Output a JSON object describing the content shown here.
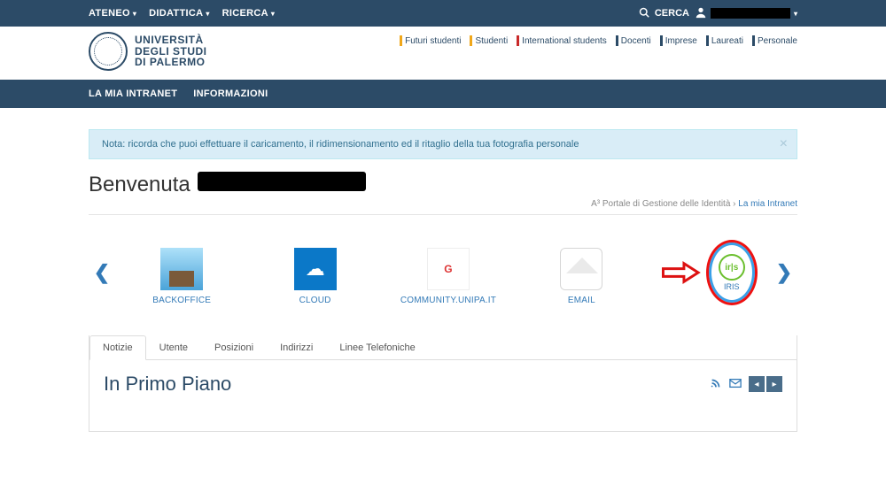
{
  "topbar": {
    "items": [
      "ATENEO",
      "DIDATTICA",
      "RICERCA"
    ],
    "search_label": "CERCA"
  },
  "quicklinks": [
    {
      "label": "Futuri studenti",
      "color": "#f0a71a"
    },
    {
      "label": "Studenti",
      "color": "#f0a71a"
    },
    {
      "label": "International students",
      "color": "#c92a2a"
    },
    {
      "label": "Docenti",
      "color": "#2c4b67"
    },
    {
      "label": "Imprese",
      "color": "#2c4b67"
    },
    {
      "label": "Laureati",
      "color": "#2c4b67"
    },
    {
      "label": "Personale",
      "color": "#2c4b67"
    }
  ],
  "logo": {
    "line1": "UNIVERSITÀ",
    "line2": "DEGLI STUDI",
    "line3": "DI PALERMO"
  },
  "nav2": {
    "items": [
      "LA MIA INTRANET",
      "INFORMAZIONI"
    ]
  },
  "alert": {
    "text": "Nota: ricorda che puoi effettuare il caricamento, il ridimensionamento ed il ritaglio della tua fotografia personale"
  },
  "welcome": {
    "greeting": "Benvenuta"
  },
  "breadcrumb": {
    "a": "A³ Portale di Gestione delle Identità",
    "b": "La mia Intranet",
    "sep": " › "
  },
  "carousel": {
    "items": [
      {
        "label": "BACKOFFICE"
      },
      {
        "label": "CLOUD"
      },
      {
        "label": "COMMUNITY.UNIPA.IT"
      },
      {
        "label": "EMAIL"
      },
      {
        "label": "IRIS"
      }
    ]
  },
  "tabs": [
    "Notizie",
    "Utente",
    "Posizioni",
    "Indirizzi",
    "Linee Telefoniche"
  ],
  "panel": {
    "title": "In Primo Piano"
  }
}
